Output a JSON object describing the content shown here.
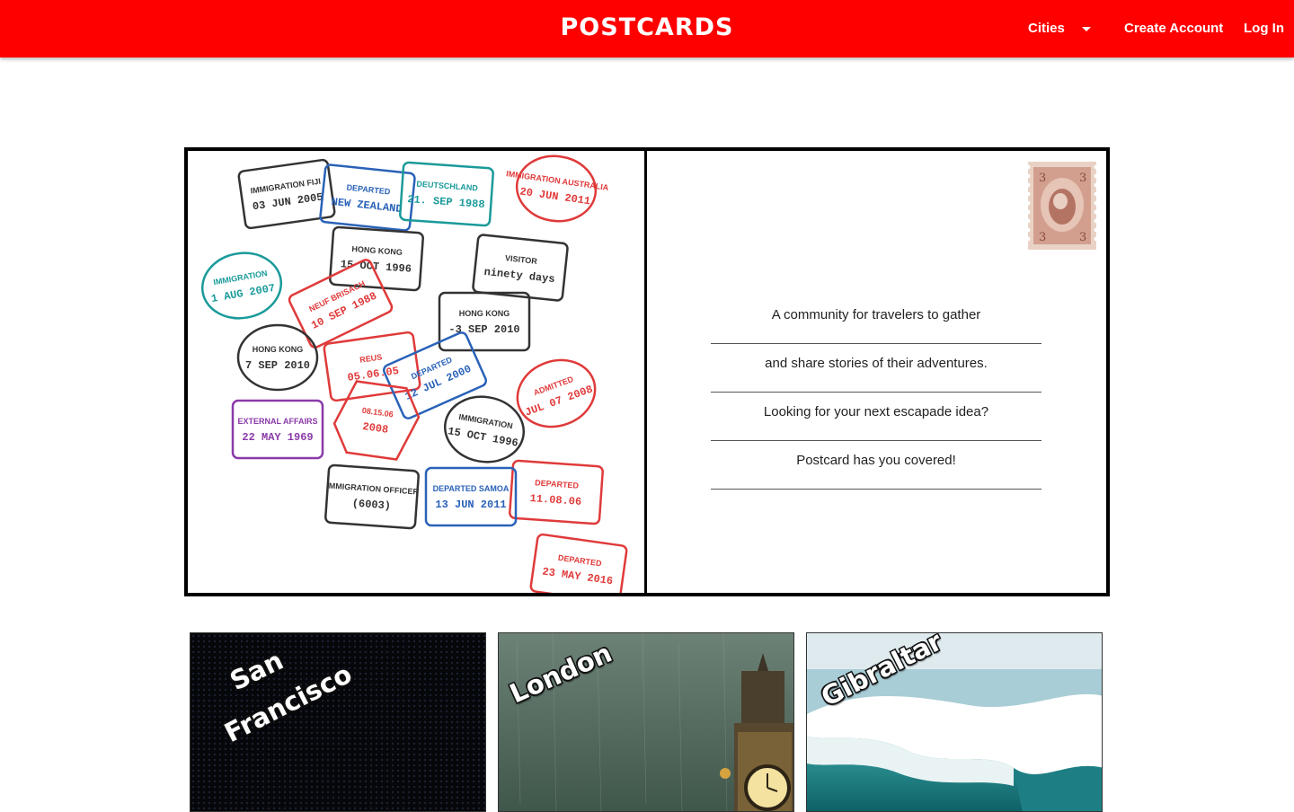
{
  "header": {
    "brand": "POSTCARDS",
    "nav": {
      "cities_label": "Cities",
      "create_account_label": "Create Account",
      "login_label": "Log In"
    },
    "background_color": "#ff0000"
  },
  "postcard": {
    "lines": [
      "A community for travelers to gather",
      "and share stories of their adventures.",
      "Looking for your next escapade idea?",
      "Postcard has you covered!"
    ],
    "stamp_images": {
      "stamps": [
        {
          "text": "IMMIGRATION FIJI",
          "sub": "03 JUN 2005",
          "color": "#333333"
        },
        {
          "text": "DEPARTED",
          "sub": "NEW ZEALAND",
          "color": "#2a62b8"
        },
        {
          "text": "DEUTSCHLAND",
          "sub": "21. SEP 1988",
          "color": "#1a9a9a"
        },
        {
          "text": "IMMIGRATION AUSTRALIA",
          "sub": "20 JUN 2011",
          "color": "#e03a3a"
        },
        {
          "text": "HONG KONG",
          "sub": "15 OCT 1996",
          "color": "#333333"
        },
        {
          "text": "VISITOR",
          "sub": "ninety days",
          "color": "#333333"
        },
        {
          "text": "IMMIGRATION",
          "sub": "1 AUG 2007",
          "color": "#1a9a9a"
        },
        {
          "text": "NEUF BRISACH",
          "sub": "10 SEP 1988",
          "color": "#e03a3a"
        },
        {
          "text": "HONG KONG",
          "sub": "-3 SEP 2010",
          "color": "#333333"
        },
        {
          "text": "HONG KONG",
          "sub": "7 SEP 2010",
          "color": "#333333"
        },
        {
          "text": "REUS",
          "sub": "05.06.05",
          "color": "#e03a3a"
        },
        {
          "text": "DEPARTED",
          "sub": "12 JUL 2000",
          "color": "#2a62b8"
        },
        {
          "text": "ADMITTED",
          "sub": "JUL 07 2008",
          "color": "#e03a3a"
        },
        {
          "text": "EXTERNAL AFFAIRS",
          "sub": "22 MAY 1969",
          "color": "#8a3aa8"
        },
        {
          "text": "08.15.06",
          "sub": "2008",
          "color": "#e03a3a"
        },
        {
          "text": "IMMIGRATION",
          "sub": "15 OCT 1996",
          "color": "#333333"
        },
        {
          "text": "DEPARTED",
          "sub": "11.08.06",
          "color": "#e03a3a"
        },
        {
          "text": "IMMIGRATION OFFICER",
          "sub": "(6003)",
          "color": "#333333"
        },
        {
          "text": "DEPARTED SAMOA",
          "sub": "13 JUN 2011",
          "color": "#2a62b8"
        },
        {
          "text": "DEPARTED",
          "sub": "23 MAY 2016",
          "color": "#e03a3a"
        }
      ]
    }
  },
  "cities": [
    {
      "name_line1": "San",
      "name_line2": "Francisco"
    },
    {
      "name_line1": "London"
    },
    {
      "name_line1": "Gibraltar"
    }
  ]
}
